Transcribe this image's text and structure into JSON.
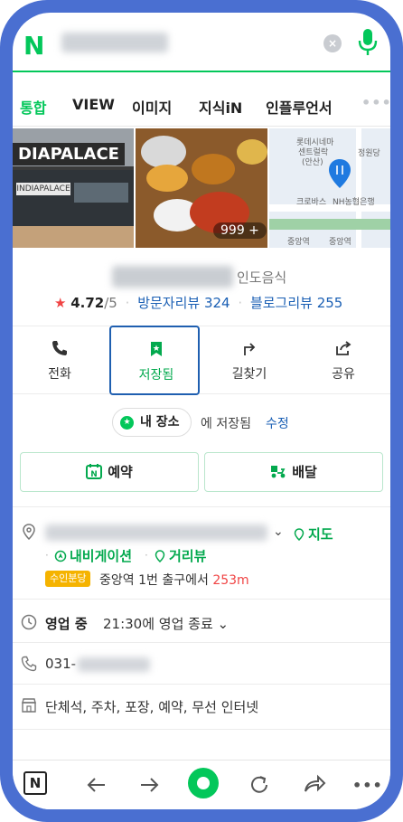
{
  "search": {
    "logo": "N",
    "query_redacted": true,
    "clear_label": "×"
  },
  "tabs": [
    {
      "label": "통합",
      "active": true
    },
    {
      "label": "VIEW",
      "active": false
    },
    {
      "label": "이미지",
      "active": false
    },
    {
      "label": "지식iN",
      "active": false
    },
    {
      "label": "인플루언서",
      "active": false
    }
  ],
  "tabs_more": "•••",
  "photos": {
    "storefront_sign": "DIAPALACE",
    "storefront_small_sign": "INDIAPALACE",
    "photo_count_badge": "999 +",
    "map_labels": [
      "롯데시네마",
      "센트럴락",
      "(안산)",
      "정원당",
      "크로바스",
      "NH농협은행",
      "중앙역",
      "중앙역"
    ]
  },
  "place": {
    "name_redacted": true,
    "category": "인도음식",
    "star": "★",
    "rating": "4.72",
    "rating_max": "/5",
    "visitor_reviews": "방문자리뷰 324",
    "blog_reviews": "블로그리뷰 255",
    "dot": "·"
  },
  "actions": [
    {
      "label": "전화",
      "icon": "phone-icon"
    },
    {
      "label": "저장됨",
      "icon": "bookmark-icon"
    },
    {
      "label": "길찾기",
      "icon": "directions-icon"
    },
    {
      "label": "공유",
      "icon": "share-icon"
    }
  ],
  "saved": {
    "pill_label": "내 장소",
    "saved_text": "에 저장됨",
    "edit_label": "수정"
  },
  "cta": {
    "booking": "예약",
    "delivery": "배달"
  },
  "address": {
    "redacted": true,
    "map_link": "지도",
    "navigation_link": "내비게이션",
    "street_view_link": "거리뷰",
    "exit_badge": "수인분당",
    "exit_text": "중앙역 1번 출구에서",
    "exit_distance": "253m"
  },
  "hours": {
    "status": "영업 중",
    "detail": "21:30에 영업 종료"
  },
  "phone": {
    "prefix": "031-",
    "rest_redacted": true
  },
  "amenities": "단체석, 주차, 포장, 예약, 무선 인터넷",
  "colors": {
    "naver_green": "#03c75a",
    "link_blue": "#1a5fb4",
    "frame_blue": "#4a6fd1",
    "star_red": "#f04444",
    "badge_yellow": "#f5b300"
  },
  "bottom_nav": {
    "n_label": "N",
    "more": "•••"
  }
}
